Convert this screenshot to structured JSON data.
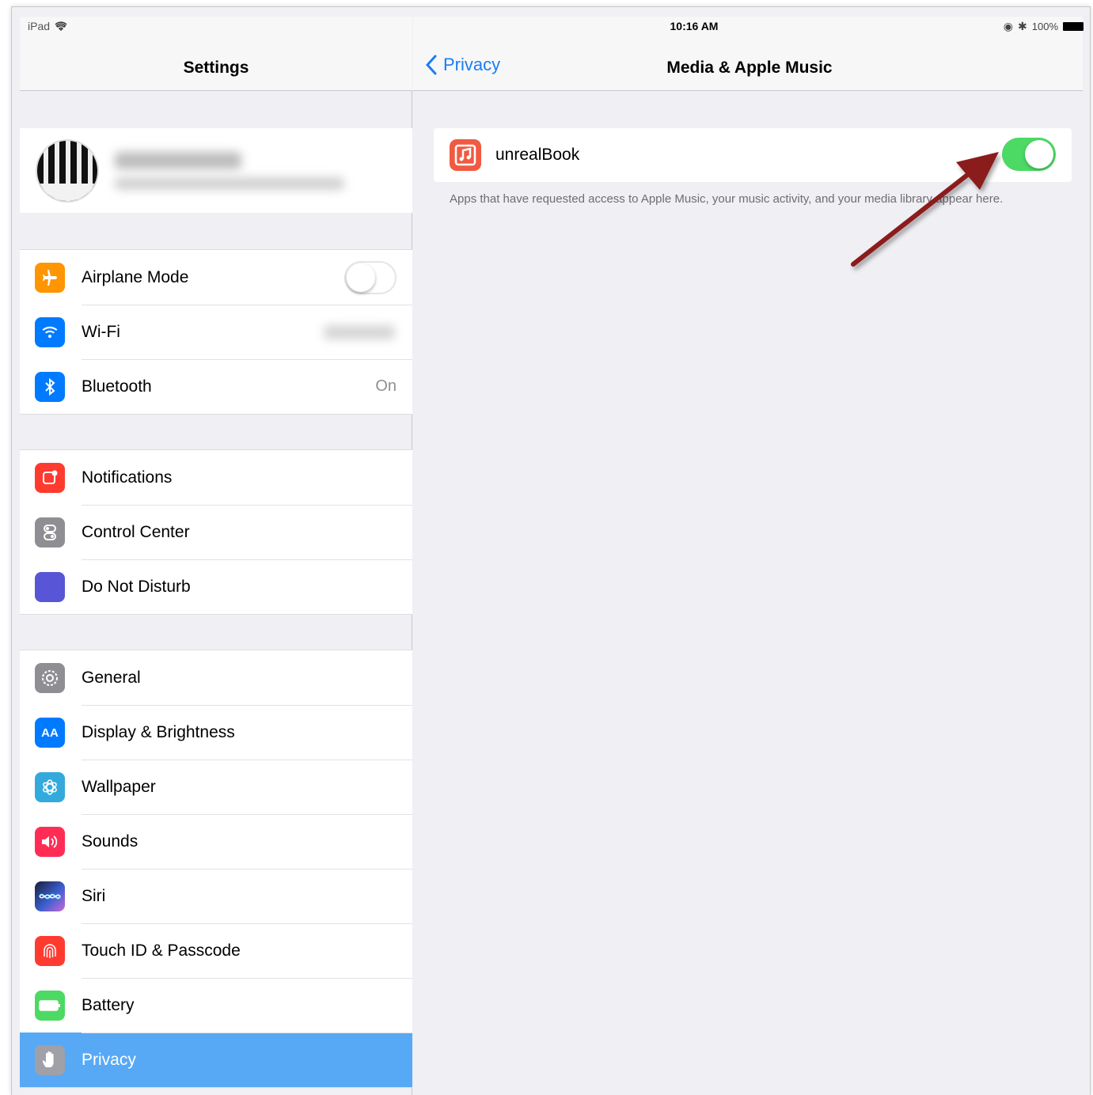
{
  "status_bar": {
    "carrier": "iPad",
    "time": "10:16 AM",
    "battery_percent": "100%"
  },
  "sidebar": {
    "title": "Settings",
    "groups": [
      {
        "items": [
          {
            "label": "Airplane Mode",
            "icon": "airplane-icon",
            "color": "#ff9500",
            "toggle": false
          },
          {
            "label": "Wi-Fi",
            "icon": "wifi-icon",
            "color": "#007aff",
            "value": ""
          },
          {
            "label": "Bluetooth",
            "icon": "bluetooth-icon",
            "color": "#007aff",
            "value": "On"
          }
        ]
      },
      {
        "items": [
          {
            "label": "Notifications",
            "icon": "notifications-icon",
            "color": "#ff3b30"
          },
          {
            "label": "Control Center",
            "icon": "control-center-icon",
            "color": "#8e8e93"
          },
          {
            "label": "Do Not Disturb",
            "icon": "moon-icon",
            "color": "#5856d6"
          }
        ]
      },
      {
        "items": [
          {
            "label": "General",
            "icon": "gear-icon",
            "color": "#8e8e93"
          },
          {
            "label": "Display & Brightness",
            "icon": "display-icon",
            "color": "#007aff"
          },
          {
            "label": "Wallpaper",
            "icon": "wallpaper-icon",
            "color": "#34aadc"
          },
          {
            "label": "Sounds",
            "icon": "sounds-icon",
            "color": "#ff2d55"
          },
          {
            "label": "Siri",
            "icon": "siri-icon",
            "color": "#1c1c3a"
          },
          {
            "label": "Touch ID & Passcode",
            "icon": "fingerprint-icon",
            "color": "#ff3b30"
          },
          {
            "label": "Battery",
            "icon": "battery-icon",
            "color": "#4cd964"
          },
          {
            "label": "Privacy",
            "icon": "hand-icon",
            "color": "#8e8e93",
            "selected": true
          }
        ]
      }
    ]
  },
  "detail": {
    "back_label": "Privacy",
    "title": "Media & Apple Music",
    "app": {
      "name": "unrealBook",
      "enabled": true,
      "icon": "music-note-icon",
      "icon_color": "#f15a42"
    },
    "footer": "Apps that have requested access to Apple Music, your music activity, and your media library appear here."
  },
  "colors": {
    "accent": "#1a7cf5",
    "toggle_on": "#4cd964",
    "selection": "#58a9f5",
    "annotation_arrow": "#8b1a1a"
  }
}
